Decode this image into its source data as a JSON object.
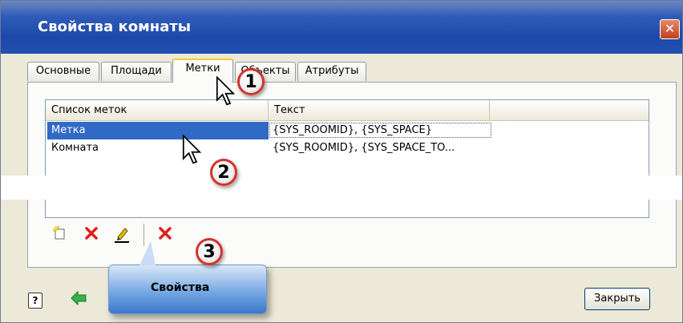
{
  "window": {
    "title": "Свойства комнаты",
    "close_symbol": "✕"
  },
  "tabs": [
    {
      "label": "Основные"
    },
    {
      "label": "Площади"
    },
    {
      "label": "Метки"
    },
    {
      "label": "Объекты"
    },
    {
      "label": "Атрибуты"
    }
  ],
  "list": {
    "headers": [
      "Список меток",
      "Текст"
    ],
    "rows": [
      {
        "name": "Метка",
        "text": "{SYS_ROOMID}, {SYS_SPACE}"
      },
      {
        "name": "Комната",
        "text": "{SYS_ROOMID}, {SYS_SPACE_TO..."
      }
    ]
  },
  "toolbar": {
    "icons": [
      "new-icon",
      "delete-icon",
      "edit-pencil-icon",
      "delete-all-icon"
    ]
  },
  "callouts": [
    "1",
    "2",
    "3"
  ],
  "tooltip": {
    "text": "Свойства"
  },
  "footer": {
    "help_symbol": "?",
    "close_label": "Закрыть"
  },
  "colors": {
    "title_bar": "#1d48a8",
    "selection": "#316ac5",
    "badge_border": "#d3332a",
    "tooltip": "#6fa3e0"
  }
}
